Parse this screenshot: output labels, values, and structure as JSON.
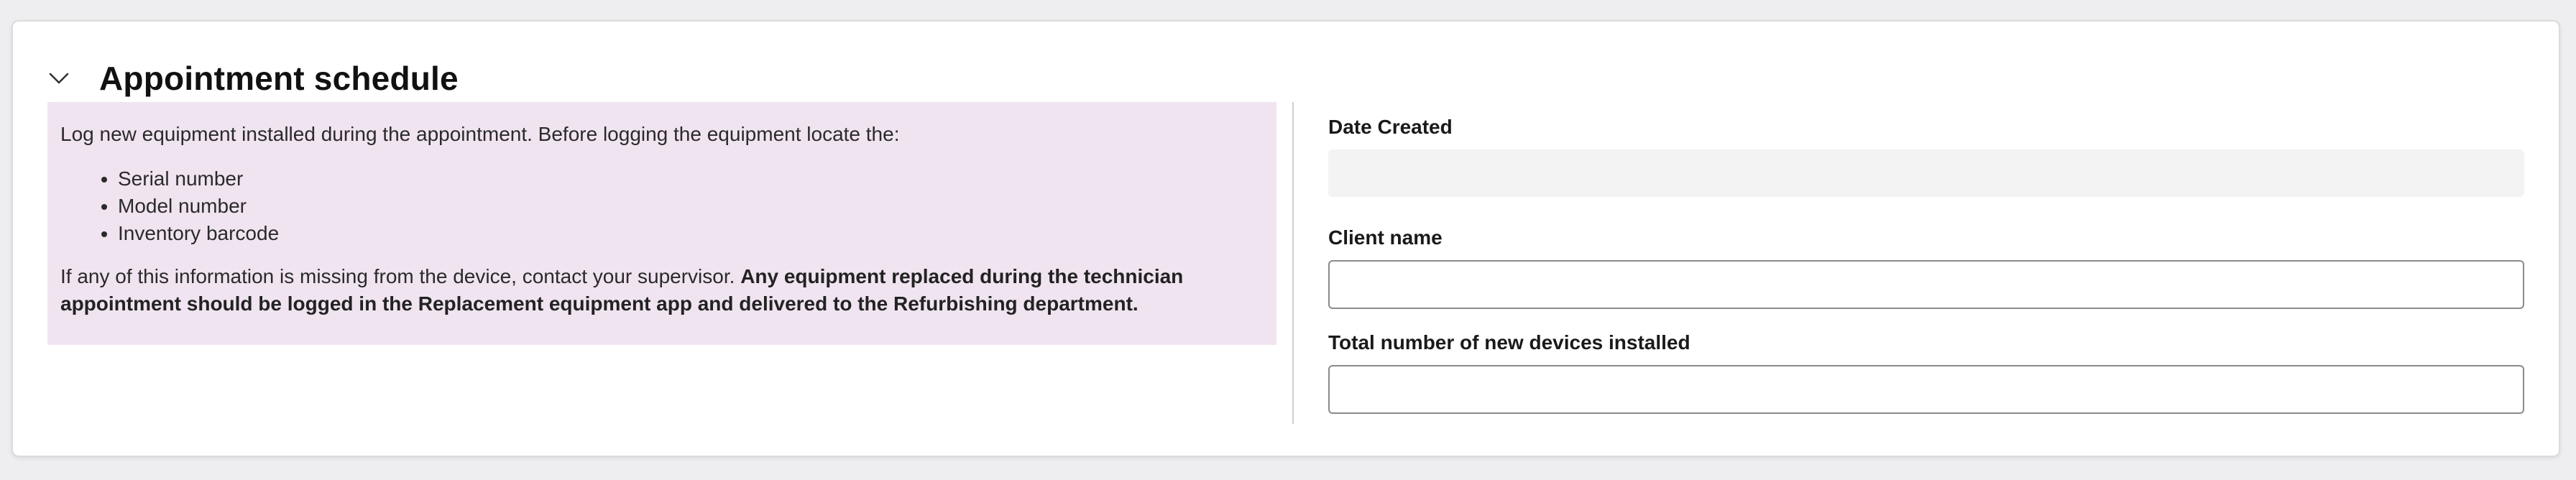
{
  "section": {
    "title": "Appointment schedule",
    "collapse_icon": "chevron-down-icon"
  },
  "info": {
    "intro": "Log new equipment installed during the appointment. Before logging the equipment locate the:",
    "items": [
      "Serial number",
      "Model number",
      "Inventory barcode"
    ],
    "note_regular": "If any of this information is missing from the device, contact your supervisor. ",
    "note_bold": "Any equipment replaced during the technician appointment should be logged in the Replacement equipment app and delivered to the Refurbishing department.",
    "background_color": "#f0e4f1"
  },
  "form": {
    "date_created": {
      "label": "Date Created",
      "value": ""
    },
    "client_name": {
      "label": "Client name",
      "value": "",
      "placeholder": ""
    },
    "devices_installed": {
      "label": "Total number of new devices installed",
      "value": "",
      "placeholder": ""
    }
  }
}
